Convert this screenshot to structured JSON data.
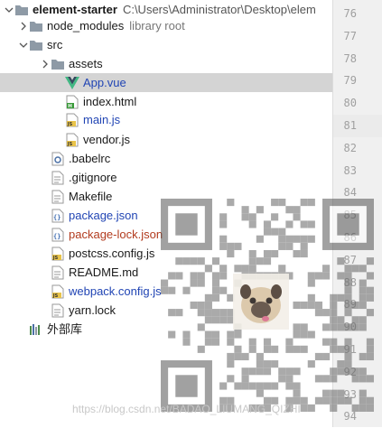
{
  "project": {
    "name": "element-starter",
    "path": "C:\\Users\\Administrator\\Desktop\\elem"
  },
  "tree": [
    {
      "label": "node_modules",
      "suffix": "library root",
      "type": "folder",
      "arrow": "collapsed",
      "color": "default"
    },
    {
      "label": "src",
      "type": "folder",
      "arrow": "expanded",
      "color": "default"
    },
    {
      "label": "assets",
      "type": "folder",
      "arrow": "collapsed",
      "color": "default"
    },
    {
      "label": "App.vue",
      "type": "vue-file",
      "color": "blue",
      "selected": true
    },
    {
      "label": "index.html",
      "type": "html-file",
      "color": "default"
    },
    {
      "label": "main.js",
      "type": "js-file",
      "color": "blue"
    },
    {
      "label": "vendor.js",
      "type": "js-file",
      "color": "default"
    },
    {
      "label": ".babelrc",
      "type": "config-file",
      "color": "default"
    },
    {
      "label": ".gitignore",
      "type": "text-file",
      "color": "default"
    },
    {
      "label": "Makefile",
      "type": "text-file",
      "color": "default"
    },
    {
      "label": "package.json",
      "type": "json-file",
      "color": "blue"
    },
    {
      "label": "package-lock.json",
      "type": "json-file",
      "color": "red"
    },
    {
      "label": "postcss.config.js",
      "type": "js-file",
      "color": "default"
    },
    {
      "label": "README.md",
      "type": "text-file",
      "color": "default"
    },
    {
      "label": "webpack.config.js",
      "type": "js-file",
      "color": "blue"
    },
    {
      "label": "yarn.lock",
      "type": "text-file",
      "color": "default"
    },
    {
      "label": "外部库",
      "type": "library",
      "color": "default"
    }
  ],
  "gutter": {
    "line_numbers": [
      "76",
      "77",
      "78",
      "79",
      "80",
      "81",
      "82",
      "83",
      "84",
      "85",
      "86",
      "87",
      "88",
      "89",
      "90",
      "91",
      "92",
      "93",
      "94"
    ],
    "highlighted": "81"
  },
  "watermark": "https://blog.csdn.net/BADAO_LIUMANG_QIZHI",
  "colors": {
    "selected_row": "#d4d4d4",
    "blue_text": "#2145b4",
    "red_text": "#b23b1e",
    "folder": "#8e9aa6",
    "vue_green": "#41b883",
    "js_yellow": "#e8c34a"
  }
}
